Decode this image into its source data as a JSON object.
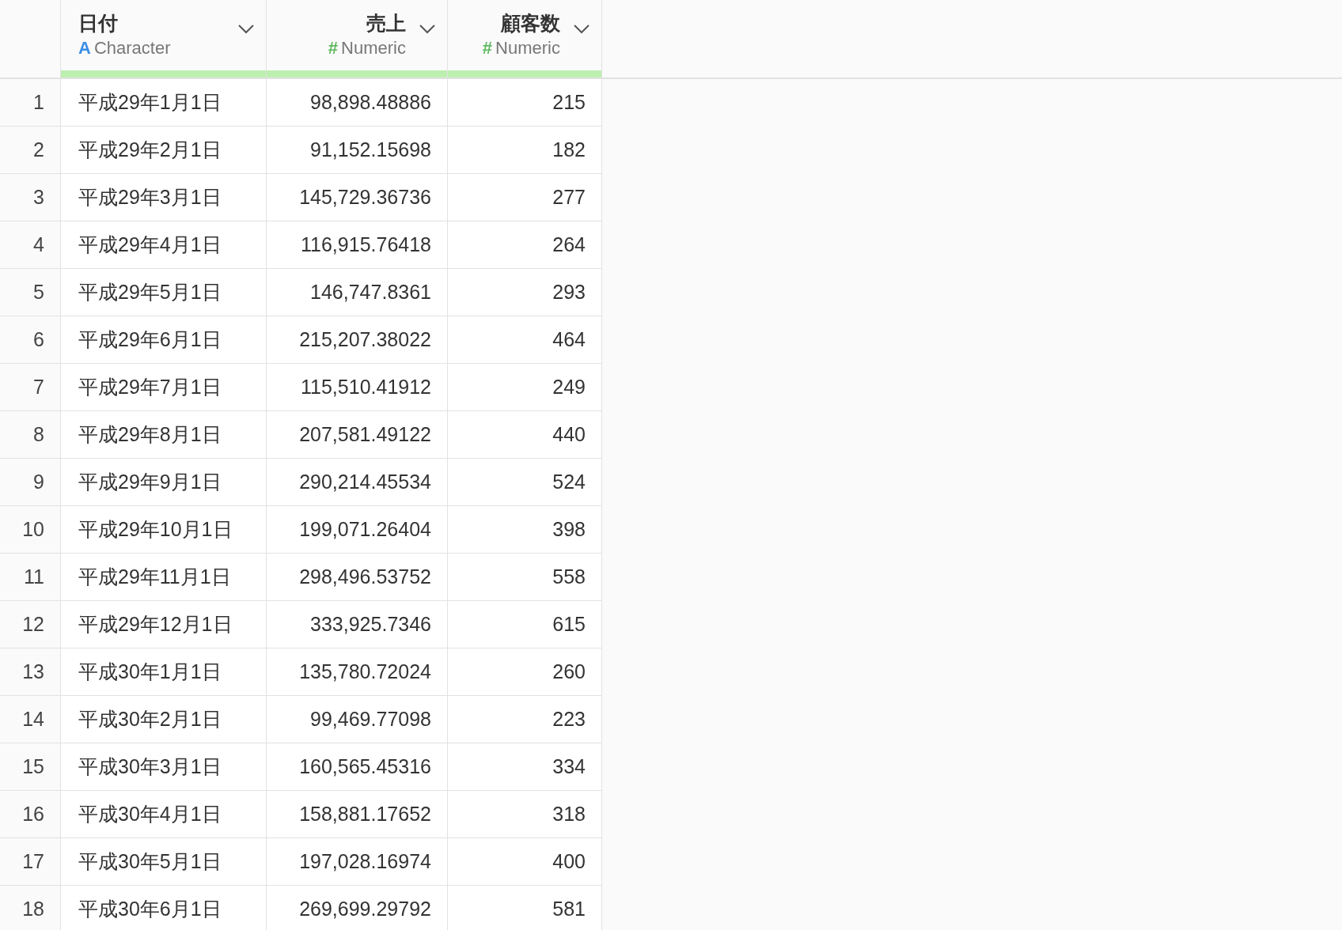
{
  "columns": [
    {
      "name": "日付",
      "kind": "character",
      "type_icon": "A",
      "type": "Character"
    },
    {
      "name": "売上",
      "kind": "numeric",
      "type_icon": "#",
      "type": "Numeric"
    },
    {
      "name": "顧客数",
      "kind": "numeric",
      "type_icon": "#",
      "type": "Numeric"
    }
  ],
  "rows": [
    {
      "number": "1",
      "cells": [
        "平成29年1月1日",
        "98,898.48886",
        "215"
      ]
    },
    {
      "number": "2",
      "cells": [
        "平成29年2月1日",
        "91,152.15698",
        "182"
      ]
    },
    {
      "number": "3",
      "cells": [
        "平成29年3月1日",
        "145,729.36736",
        "277"
      ]
    },
    {
      "number": "4",
      "cells": [
        "平成29年4月1日",
        "116,915.76418",
        "264"
      ]
    },
    {
      "number": "5",
      "cells": [
        "平成29年5月1日",
        "146,747.8361",
        "293"
      ]
    },
    {
      "number": "6",
      "cells": [
        "平成29年6月1日",
        "215,207.38022",
        "464"
      ]
    },
    {
      "number": "7",
      "cells": [
        "平成29年7月1日",
        "115,510.41912",
        "249"
      ]
    },
    {
      "number": "8",
      "cells": [
        "平成29年8月1日",
        "207,581.49122",
        "440"
      ]
    },
    {
      "number": "9",
      "cells": [
        "平成29年9月1日",
        "290,214.45534",
        "524"
      ]
    },
    {
      "number": "10",
      "cells": [
        "平成29年10月1日",
        "199,071.26404",
        "398"
      ]
    },
    {
      "number": "11",
      "cells": [
        "平成29年11月1日",
        "298,496.53752",
        "558"
      ]
    },
    {
      "number": "12",
      "cells": [
        "平成29年12月1日",
        "333,925.7346",
        "615"
      ]
    },
    {
      "number": "13",
      "cells": [
        "平成30年1月1日",
        "135,780.72024",
        "260"
      ]
    },
    {
      "number": "14",
      "cells": [
        "平成30年2月1日",
        "99,469.77098",
        "223"
      ]
    },
    {
      "number": "15",
      "cells": [
        "平成30年3月1日",
        "160,565.45316",
        "334"
      ]
    },
    {
      "number": "16",
      "cells": [
        "平成30年4月1日",
        "158,881.17652",
        "318"
      ]
    },
    {
      "number": "17",
      "cells": [
        "平成30年5月1日",
        "197,028.16974",
        "400"
      ]
    },
    {
      "number": "18",
      "cells": [
        "平成30年6月1日",
        "269,699.29792",
        "581"
      ]
    }
  ]
}
